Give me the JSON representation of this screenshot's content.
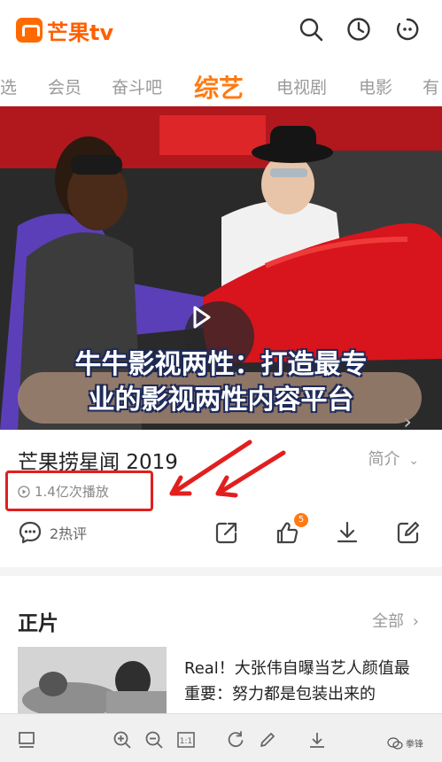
{
  "app": {
    "logo_text": "芒果tv",
    "brand_color": "#ff6a00"
  },
  "header_icons": [
    "search-icon",
    "history-icon",
    "profile-icon"
  ],
  "tabs": [
    {
      "label": "选"
    },
    {
      "label": "会员"
    },
    {
      "label": "奋斗吧"
    },
    {
      "label": "综艺"
    },
    {
      "label": "电视剧"
    },
    {
      "label": "电影"
    },
    {
      "label": "有"
    }
  ],
  "active_tab": "综艺",
  "overlay": {
    "line1": "牛牛影视两性：打造最专",
    "line2": "业的影视两性内容平台"
  },
  "show": {
    "title": "芒果捞星闻 2019",
    "intro_label": "简介",
    "play_count": "1.4亿次播放",
    "comments": "2热评",
    "like_badge": "5"
  },
  "section": {
    "title": "正片",
    "all_label": "全部",
    "item_title": "Real！大张伟自曝当艺人颜值最重要：努力都是包装出来的"
  },
  "bottom_toolbar": [
    "layout-icon",
    "zoom-in-icon",
    "zoom-out-icon",
    "actual-size-icon",
    "rotate-icon",
    "edit-icon",
    "download-icon"
  ],
  "watermark": "拳锋",
  "colors": {
    "accent": "#ff7a12",
    "highlight_box": "#e11f1f"
  }
}
